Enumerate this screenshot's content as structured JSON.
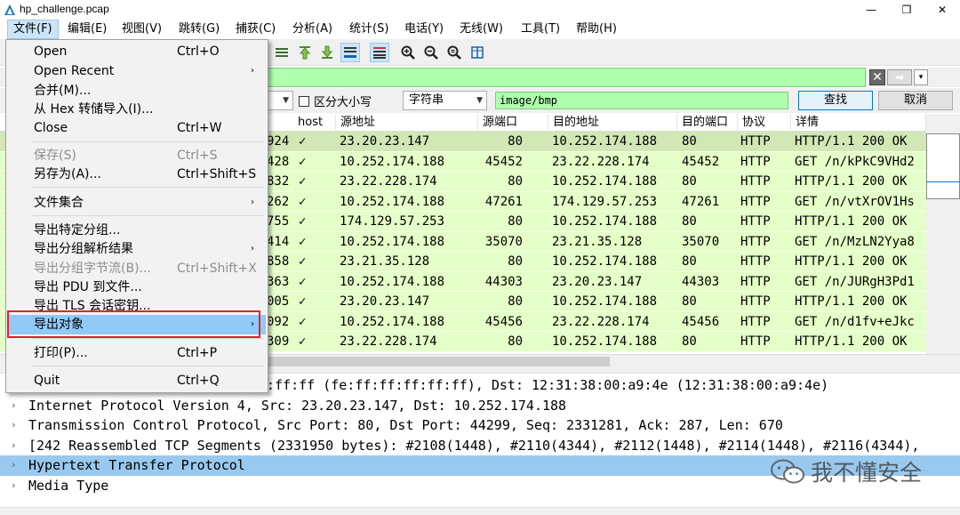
{
  "window": {
    "title": "hp_challenge.pcap",
    "controls": {
      "minimize": "—",
      "maximize": "❐",
      "close": "✕"
    }
  },
  "menubar": [
    "文件(F)",
    "编辑(E)",
    "视图(V)",
    "跳转(G)",
    "捕获(C)",
    "分析(A)",
    "统计(S)",
    "电话(Y)",
    "无线(W)",
    "工具(T)",
    "帮助(H)"
  ],
  "file_menu": {
    "items": [
      {
        "label": "Open",
        "shortcut": "Ctrl+O"
      },
      {
        "label": "Open Recent",
        "submenu": "›"
      },
      {
        "label": "合并(M)..."
      },
      {
        "label": "从 Hex 转储导入(I)..."
      },
      {
        "label": "Close",
        "shortcut": "Ctrl+W"
      },
      {
        "label": "保存(S)",
        "shortcut": "Ctrl+S",
        "disabled": true
      },
      {
        "label": "另存为(A)...",
        "shortcut": "Ctrl+Shift+S"
      },
      {
        "label": "文件集合",
        "submenu": "›"
      },
      {
        "label": "导出特定分组..."
      },
      {
        "label": "导出分组解析结果",
        "submenu": "›"
      },
      {
        "label": "导出分组字节流(B)...",
        "shortcut": "Ctrl+Shift+X",
        "disabled": true
      },
      {
        "label": "导出 PDU 到文件..."
      },
      {
        "label": "导出 TLS 会话密钥..."
      },
      {
        "label": "导出对象",
        "submenu": "›",
        "highlighted": true
      },
      {
        "label": "打印(P)...",
        "shortcut": "Ctrl+P"
      },
      {
        "label": "Quit",
        "shortcut": "Ctrl+Q"
      }
    ]
  },
  "filter_bar": {
    "value": "",
    "clear_icon": "✕",
    "apply_icon": "➡",
    "dropdown_icon": "▾"
  },
  "find_bar": {
    "scope_value": "",
    "case_sensitive_label": "区分大小写",
    "search_type": "字符串",
    "search_value": "image/bmp",
    "find_button": "查找",
    "cancel_button": "取消"
  },
  "packet_list": {
    "columns": [
      "host",
      "源地址",
      "源端口",
      "目的地址",
      "目的端口",
      "协议",
      "详情"
    ],
    "rows": [
      {
        "no": "924",
        "host": "✓",
        "src": "23.20.23.147",
        "sport": "80",
        "dst": "10.252.174.188",
        "dport": "80",
        "proto": "HTTP",
        "info": "HTTP/1.1 200 OK"
      },
      {
        "no": "428",
        "host": "✓",
        "src": "10.252.174.188",
        "sport": "45452",
        "dst": "23.22.228.174",
        "dport": "45452",
        "proto": "HTTP",
        "info": "GET /n/kPkC9VHd2"
      },
      {
        "no": "832",
        "host": "✓",
        "src": "23.22.228.174",
        "sport": "80",
        "dst": "10.252.174.188",
        "dport": "80",
        "proto": "HTTP",
        "info": "HTTP/1.1 200 OK"
      },
      {
        "no": "262",
        "host": "✓",
        "src": "10.252.174.188",
        "sport": "47261",
        "dst": "174.129.57.253",
        "dport": "47261",
        "proto": "HTTP",
        "info": "GET /n/vtXrOV1Hs"
      },
      {
        "no": "755",
        "host": "✓",
        "src": "174.129.57.253",
        "sport": "80",
        "dst": "10.252.174.188",
        "dport": "80",
        "proto": "HTTP",
        "info": "HTTP/1.1 200 OK"
      },
      {
        "no": "414",
        "host": "✓",
        "src": "10.252.174.188",
        "sport": "35070",
        "dst": "23.21.35.128",
        "dport": "35070",
        "proto": "HTTP",
        "info": "GET /n/MzLN2Yya8"
      },
      {
        "no": "858",
        "host": "✓",
        "src": "23.21.35.128",
        "sport": "80",
        "dst": "10.252.174.188",
        "dport": "80",
        "proto": "HTTP",
        "info": "HTTP/1.1 200 OK"
      },
      {
        "no": "363",
        "host": "✓",
        "src": "10.252.174.188",
        "sport": "44303",
        "dst": "23.20.23.147",
        "dport": "44303",
        "proto": "HTTP",
        "info": "GET /n/JURgH3Pd1"
      },
      {
        "no": "005",
        "host": "✓",
        "src": "23.20.23.147",
        "sport": "80",
        "dst": "10.252.174.188",
        "dport": "80",
        "proto": "HTTP",
        "info": "HTTP/1.1 200 OK"
      },
      {
        "no": "092",
        "host": "✓",
        "src": "10.252.174.188",
        "sport": "45456",
        "dst": "23.22.228.174",
        "dport": "45456",
        "proto": "HTTP",
        "info": "GET /n/d1fv+eJkc"
      },
      {
        "no": "309",
        "host": "✓",
        "src": "23.22.228.174",
        "sport": "80",
        "dst": "10.252.174.188",
        "dport": "80",
        "proto": "HTTP",
        "info": "HTTP/1.1 200 OK"
      }
    ]
  },
  "details": [
    {
      "text": ":ff:ff (fe:ff:ff:ff:ff:ff), Dst: 12:31:38:00:a9:4e (12:31:38:00:a9:4e)",
      "expander": ""
    },
    {
      "text": "Internet Protocol Version 4, Src: 23.20.23.147, Dst: 10.252.174.188",
      "expander": "›"
    },
    {
      "text": "Transmission Control Protocol, Src Port: 80, Dst Port: 44299, Seq: 2331281, Ack: 287, Len: 670",
      "expander": "›"
    },
    {
      "text": "[242 Reassembled TCP Segments (2331950 bytes): #2108(1448), #2110(4344), #2112(1448), #2114(1448), #2116(4344),",
      "expander": "›"
    },
    {
      "text": "Hypertext Transfer Protocol",
      "expander": "›",
      "selected": true
    },
    {
      "text": "Media Type",
      "expander": "›"
    }
  ],
  "watermark": {
    "text": "我不懂安全",
    "icon": "wechat-icon"
  },
  "colors": {
    "filter_green": "#afffaf",
    "http_row": "#e4ffc7",
    "selection_blue": "#99c9ef",
    "menu_highlight": "#91c9f7",
    "highlight_frame": "#e2232a"
  }
}
